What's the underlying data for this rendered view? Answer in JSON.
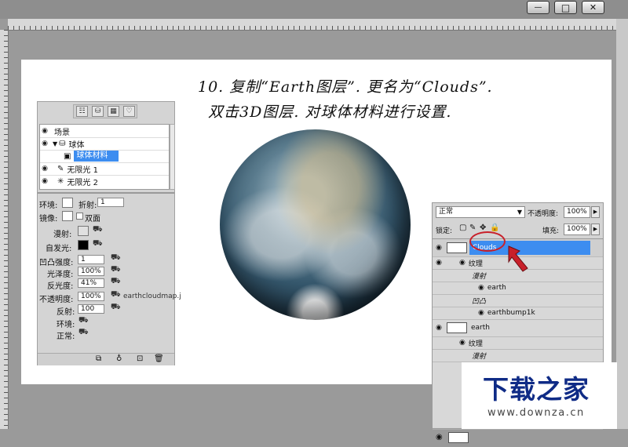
{
  "window": {
    "minimize_glyph": "—",
    "maximize_glyph": "□",
    "close_glyph": "✕"
  },
  "instructions": {
    "line1": "10. 复制“Earth图层”. 更名为“Clouds”.",
    "line2": "双击3D图层. 对球体材料进行设置."
  },
  "panel_3d": {
    "tabs": [
      "scene-tab",
      "mesh-tab",
      "materials-tab",
      "lights-tab"
    ],
    "scene_items": [
      {
        "label": "场景"
      },
      {
        "label": "球体"
      },
      {
        "label": "球体材料"
      },
      {
        "label": "无限光 1"
      },
      {
        "label": "无限光 2"
      }
    ],
    "props": {
      "env_label": "环境:",
      "refract_label": "折射:",
      "refract_value": "1",
      "mirror_label": "镜像:",
      "double_side_label": "双面",
      "diffuse_label": "漫射:",
      "self_illum_label": "自发光:",
      "bump_label": "凹凸强度:",
      "bump_value": "1",
      "gloss_label": "光泽度:",
      "gloss_value": "100%",
      "shine_label": "反光度:",
      "shine_value": "41%",
      "opacity_label": "不透明度:",
      "opacity_value": "100%",
      "opacity_texture": "earthcloudmap.j",
      "reflect_label": "反射:",
      "reflect_value": "100",
      "env2_label": "环境:",
      "normal_label": "正常:"
    }
  },
  "layers_panel": {
    "blend_mode": "正常",
    "opacity_label": "不透明度:",
    "opacity_value": "100%",
    "lock_label": "锁定:",
    "fill_label": "填充:",
    "fill_value": "100%",
    "rows": [
      {
        "label": "Clouds"
      },
      {
        "label": "纹理"
      },
      {
        "label": "漫射"
      },
      {
        "label": "earth"
      },
      {
        "label": "凹凸"
      },
      {
        "label": "earthbump1k"
      },
      {
        "label": "earth"
      },
      {
        "label": "纹理"
      },
      {
        "label": "漫射"
      }
    ],
    "highlight_color": "#3d8df0",
    "annotation_color": "#c8202a"
  },
  "watermark": {
    "title": "下载之家",
    "url": "www.downza.cn"
  }
}
